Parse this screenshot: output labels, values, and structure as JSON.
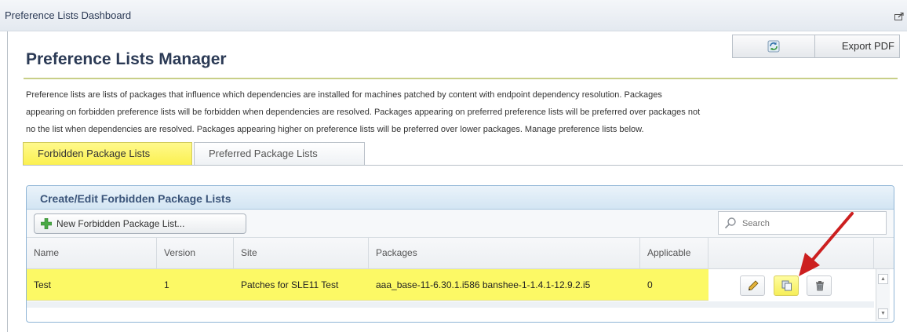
{
  "dashboard": {
    "title": "Preference Lists Dashboard"
  },
  "toolbar": {
    "export_label": "Export PDF"
  },
  "page": {
    "title": "Preference Lists Manager"
  },
  "description": {
    "lines": [
      "Preference lists are lists of packages that influence which dependencies are installed for machines patched by content with endpoint dependency resolution. Packages",
      "appearing on forbidden preference lists will be forbidden when dependencies are resolved. Packages appearing on preferred preference lists will be preferred over packages not",
      "no the list when dependencies are resolved. Packages appearing higher on preference lists will be preferred over lower packages. Manage preference lists below."
    ]
  },
  "tabs": [
    {
      "label": "Forbidden Package Lists",
      "active": true
    },
    {
      "label": "Preferred Package Lists",
      "active": false
    }
  ],
  "panel": {
    "title": "Create/Edit Forbidden Package Lists",
    "new_button": "New Forbidden Package List...",
    "search_placeholder": "Search",
    "columns": [
      "Name",
      "Version",
      "Site",
      "Packages",
      "Applicable"
    ],
    "rows": [
      {
        "name": "Test",
        "version": "1",
        "site": "Patches for SLE11 Test",
        "packages": "aaa_base-11-6.30.1.i586 banshee-1-1.4.1-12.9.2.i5",
        "applicable": "0"
      }
    ]
  },
  "icons": {
    "collapse": "collapse-icon",
    "refresh": "refresh-icon",
    "plus": "plus-icon",
    "search": "search-icon",
    "edit": "pencil-icon",
    "copy": "copy-icon",
    "delete": "trash-icon"
  },
  "colors": {
    "active_tab": "#fbf04e",
    "selected_row": "#fcf965",
    "annotation_arrow": "#cc1f1f"
  }
}
